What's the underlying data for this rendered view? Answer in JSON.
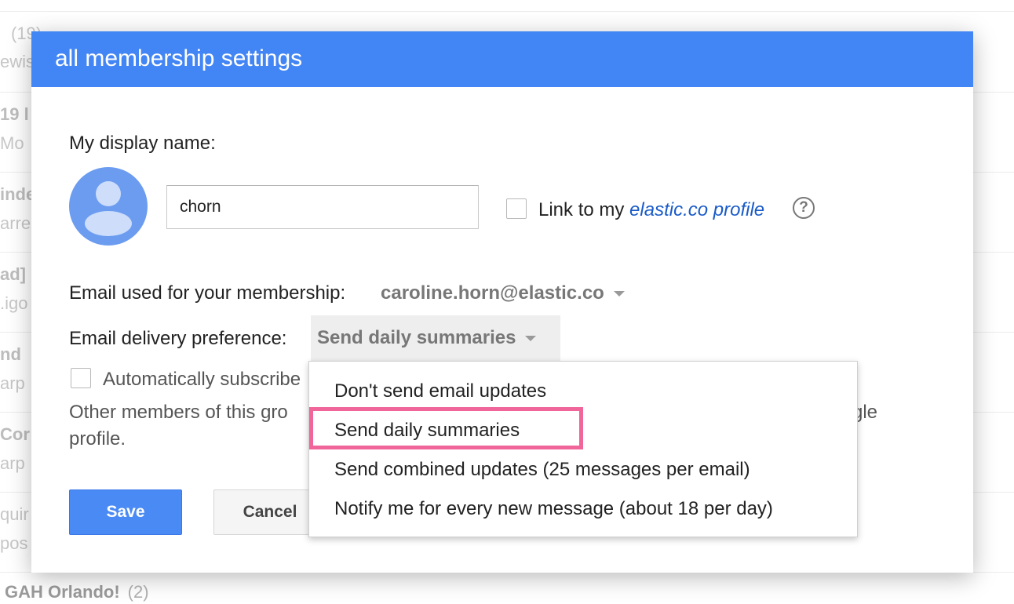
{
  "background_list": {
    "rows": [
      {
        "line1": "(19)",
        "line2": "ewis"
      },
      {
        "line1": "19 l",
        "line2": "Mo"
      },
      {
        "line1": "inde",
        "line2": "arre"
      },
      {
        "line1": "ad]",
        "line2": ".igo"
      },
      {
        "line1": "nd",
        "line2": "arp"
      },
      {
        "line1": "Cor",
        "line2": "arp"
      },
      {
        "line1": "quir",
        "line2": "pos"
      }
    ],
    "last_row": {
      "title": "GAH Orlando!",
      "count": "(2)"
    }
  },
  "dialog": {
    "title": "all membership settings",
    "display_name_label": "My display name:",
    "display_name_value": "chorn",
    "link_profile_prefix": "Link to my ",
    "link_profile_link": "elastic.co profile",
    "help_symbol": "?",
    "email_label": "Email used for your membership:",
    "email_value": "caroline.horn@elastic.co",
    "delivery_label": "Email delivery preference:",
    "delivery_value": "Send daily summaries",
    "auto_subscribe_label": "Automatically subscribe",
    "other_members_text": "Other members of this gro",
    "other_members_tail": "gle",
    "profile_text": "profile.",
    "save_label": "Save",
    "cancel_label": "Cancel"
  },
  "delivery_menu": {
    "options": [
      "Don't send email updates",
      "Send daily summaries",
      "Send combined updates (25 messages per email)",
      "Notify me for every new message (about 18 per day)"
    ],
    "highlighted_index": 1
  },
  "colors": {
    "header": "#4285f4",
    "primary_button": "#4a8af4",
    "highlight_box": "#f0669a",
    "link": "#1a5bc8"
  }
}
